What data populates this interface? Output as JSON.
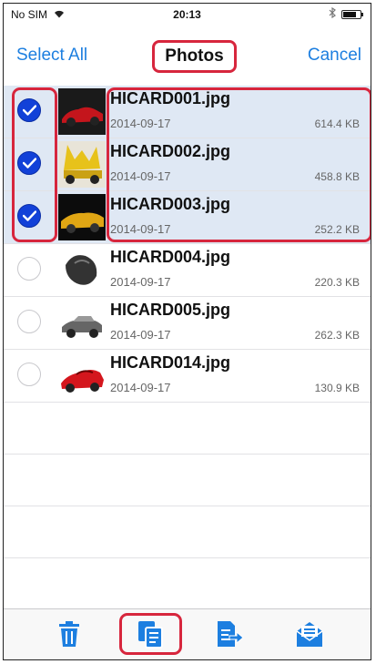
{
  "status_bar": {
    "carrier": "No SIM",
    "time": "20:13",
    "battery_level": 0.75
  },
  "nav": {
    "select_all": "Select All",
    "title": "Photos",
    "cancel": "Cancel"
  },
  "files": [
    {
      "name": "HICARD001.jpg",
      "date": "2014-09-17",
      "size": "614.4 KB",
      "selected": true
    },
    {
      "name": "HICARD002.jpg",
      "date": "2014-09-17",
      "size": "458.8 KB",
      "selected": true
    },
    {
      "name": "HICARD003.jpg",
      "date": "2014-09-17",
      "size": "252.2 KB",
      "selected": true
    },
    {
      "name": "HICARD004.jpg",
      "date": "2014-09-17",
      "size": "220.3 KB",
      "selected": false
    },
    {
      "name": "HICARD005.jpg",
      "date": "2014-09-17",
      "size": "262.3 KB",
      "selected": false
    },
    {
      "name": "HICARD014.jpg",
      "date": "2014-09-17",
      "size": "130.9 KB",
      "selected": false
    }
  ],
  "toolbar": {
    "items": [
      {
        "icon": "trash-icon",
        "color": "#1d7fe0"
      },
      {
        "icon": "copy-icon",
        "color": "#1d7fe0"
      },
      {
        "icon": "export-icon",
        "color": "#1d7fe0"
      },
      {
        "icon": "mail-icon",
        "color": "#1d7fe0"
      }
    ]
  },
  "colors": {
    "accent": "#1d7fe0",
    "check": "#1241d8",
    "highlight": "#d7263d",
    "selected_row": "#dfe8f4"
  }
}
